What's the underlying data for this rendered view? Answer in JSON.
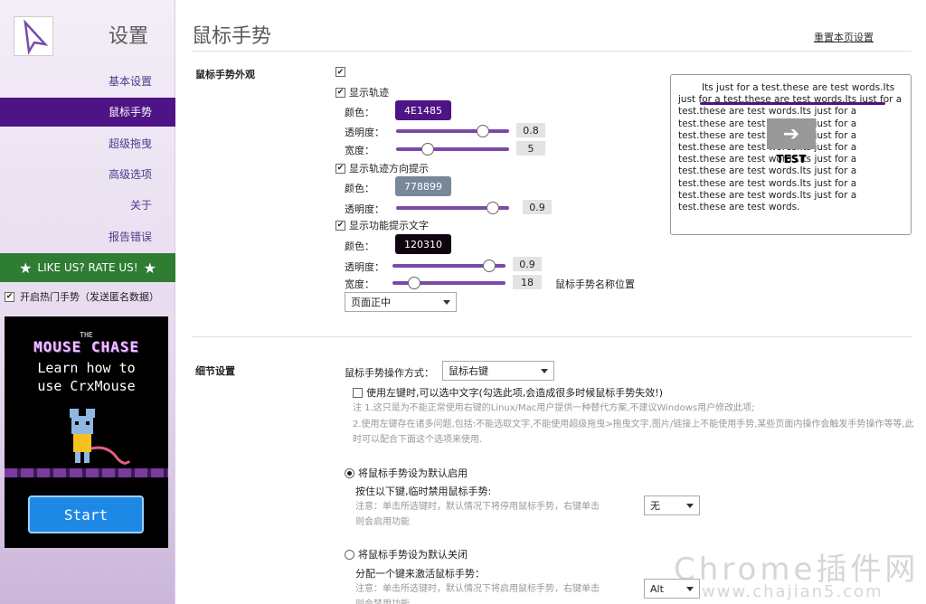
{
  "sidebar": {
    "title": "设置",
    "items": [
      {
        "label": "基本设置",
        "active": false
      },
      {
        "label": "鼠标手势",
        "active": true
      },
      {
        "label": "超级拖曳",
        "active": false
      },
      {
        "label": "高级选项",
        "active": false
      },
      {
        "label": "关于",
        "active": false
      },
      {
        "label": "报告错误",
        "active": false
      }
    ],
    "rate_label": "LIKE US? RATE US!",
    "hot_gesture_label": "开启热门手势（发送匿名数据）",
    "ad": {
      "the": "THE",
      "title": "MOUSE CHASE",
      "line1": "Learn how to",
      "line2": "use CrxMouse",
      "start": "Start"
    }
  },
  "header": {
    "title": "鼠标手势",
    "reset_link": "重置本页设置"
  },
  "appearance": {
    "section_label": "鼠标手势外观",
    "show_trail": "显示轨迹",
    "color_label": "颜色：",
    "opacity_label": "透明度：",
    "width_label": "宽度：",
    "trail_color": "4E1485",
    "trail_opacity": "0.8",
    "trail_width": "5",
    "show_direction": "显示轨迹方向提示",
    "direction_color": "778899",
    "direction_opacity": "0.9",
    "show_text": "显示功能提示文字",
    "text_color": "120310",
    "text_opacity": "0.9",
    "text_width": "18",
    "name_position_label": "鼠标手势名称位置",
    "position_value": "页面正中",
    "preview_text": "Its just for a test.these are test words.Its just for a test.these are test words.Its just for a test.these are test words.Its just for a test.these are test words.Its just for a test.these are test words.Its just for a test.these are test words.Its just for a test.these are test words.Its just for a test.these are test words.Its just for a test.these are test words.Its just for a test.these are test words.Its just for a test.these are test words.",
    "preview_test": "TEST"
  },
  "details": {
    "section_label": "细节设置",
    "operation_label": "鼠标手势操作方式：",
    "operation_value": "鼠标右键",
    "left_click_label": "使用左键时,可以选中文字(勾选此项,会造成很多时候鼠标手势失效!)",
    "note1": "注 1.这只是为不能正常使用右键的Linux/Mac用户提供一种替代方案,不建议Windows用户修改此项;",
    "note2": "2.使用左键存在诸多问题,包括:不能选取文字,不能使用超级拖曳>拖曳文字,图片/链接上不能使用手势,某些页面内操作会触发手势操作等等,此时可以配合下面这个选项来使用.",
    "default_on_label": "将鼠标手势设为默认启用",
    "hold_key_label": "按住以下键,临时禁用鼠标手势:",
    "hold_note_line1": "注意：单击所选键时，默认情况下将停用鼠标手势，右键单击",
    "hold_note_line2": "则会启用功能",
    "hold_key_value": "无",
    "default_off_label": "将鼠标手势设为默认关闭",
    "assign_key_label": "分配一个键来激活鼠标手势：",
    "assign_note_line1": "注意：单击所选键时，默认情况下将启用鼠标手势，右键单击",
    "assign_note_line2": "则会禁用功能",
    "assign_key_value": "Alt"
  },
  "watermark": {
    "text": "Chrome插件网",
    "url": "www.chajian5.com"
  },
  "colors": {
    "accent": "#4E1485",
    "direction": "#778899",
    "text_color": "#120310",
    "rate_green": "#2e7d32"
  },
  "sliders": {
    "trail_opacity": 0.8,
    "trail_width": 0.25,
    "direction_opacity": 0.9,
    "text_opacity": 0.9,
    "text_width": 0.15
  }
}
